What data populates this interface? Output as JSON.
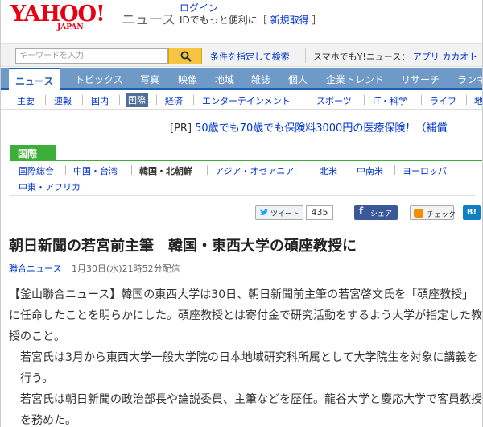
{
  "header": {
    "logo_text": "YAHOO!",
    "logo_sub": "JAPAN",
    "service_name": "ニュース",
    "login_label": "ログイン",
    "id_prompt": "IDでもっと便利に",
    "signup_label": "新規取得"
  },
  "search": {
    "placeholder": "キーワードを入力",
    "condition_link": "条件を指定して検索",
    "sp_label": "スマホでもY!ニュース：",
    "app_link": "アプリ",
    "katolink": "カカオト"
  },
  "tabs": [
    "ニュース",
    "トピックス",
    "写真",
    "映像",
    "地域",
    "雑誌",
    "個人",
    "企業トレンド",
    "リサーチ",
    "ランキ"
  ],
  "subnav": [
    "主要",
    "速報",
    "国内",
    "国際",
    "経済",
    "エンターテインメント",
    "スポーツ",
    "IT・科学",
    "ライフ",
    "地"
  ],
  "pr": {
    "prefix": "[PR]",
    "text": "50歳でも70歳でも保険料3000円の医療保険！（補償"
  },
  "category": {
    "label": "国際",
    "links": [
      "国際総合",
      "中国・台湾",
      "韓国・北朝鮮",
      "アジア・オセアニア",
      "北米",
      "中南米",
      "ヨーロッパ",
      "中東・アフリカ"
    ]
  },
  "social": {
    "tweet_label": "ツイート",
    "tweet_count": "435",
    "share_label": "シェア",
    "check_label": "チェック",
    "hatena_label": "B!"
  },
  "article": {
    "headline": "朝日新聞の若宮前主筆　韓国・東西大学の碩座教授に",
    "source": "聯合ニュース",
    "date": "1月30日(水)21時52分配信",
    "paragraphs": [
      "【釜山聯合ニュース】韓国の東西大学は30日、朝日新聞前主筆の若宮啓文氏を「碩座教授」に任命したことを明らかにした。碩座教授とは寄付金で研究活動をするよう大学が指定した教授のこと。",
      "若宮氏は3月から東西大学一般大学院の日本地域研究科所属として大学院生を対象に講義を行う。",
      "若宮氏は朝日新聞の政治部長や論説委員、主筆などを歴任。龍谷大学と慶応大学で客員教授を務めた。"
    ]
  },
  "colors": {
    "yahoo_red": "#e60012",
    "link_blue": "#0033cc",
    "tab_bar": "#6f99c7",
    "category_green": "#3cae3a"
  }
}
